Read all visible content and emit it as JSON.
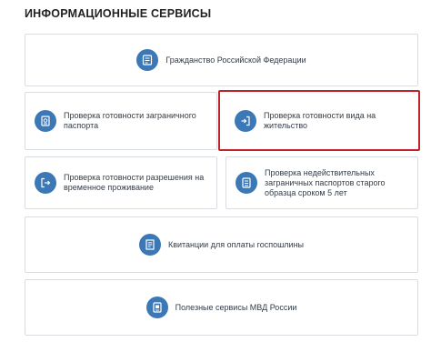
{
  "section_title": "ИНФОРМАЦИОННЫЕ СЕРВИСЫ",
  "services": [
    {
      "label": "Гражданство Российской Федерации",
      "icon": "citizenship-icon"
    },
    {
      "label_lines": [
        "Проверка готовности заграничного",
        "паспорта"
      ],
      "icon": "passport-icon"
    },
    {
      "label_lines": [
        "Проверка готовности вида на",
        "жительство"
      ],
      "icon": "residence-permit-icon",
      "highlighted": true
    },
    {
      "label_lines": [
        "Проверка готовности разрешения на",
        "временное проживание"
      ],
      "icon": "temporary-residence-icon"
    },
    {
      "label_lines": [
        "Проверка недействительных",
        "заграничных паспортов старого",
        "образца сроком 5 лет"
      ],
      "icon": "invalid-passport-icon"
    },
    {
      "label": "Квитанции для оплаты госпошлины",
      "icon": "receipt-icon"
    },
    {
      "label": "Полезные сервисы МВД России",
      "icon": "mvd-services-icon"
    }
  ],
  "colors": {
    "icon_background": "#3b78b5",
    "highlight_border": "#c0232b",
    "card_border": "#d9dde2"
  }
}
